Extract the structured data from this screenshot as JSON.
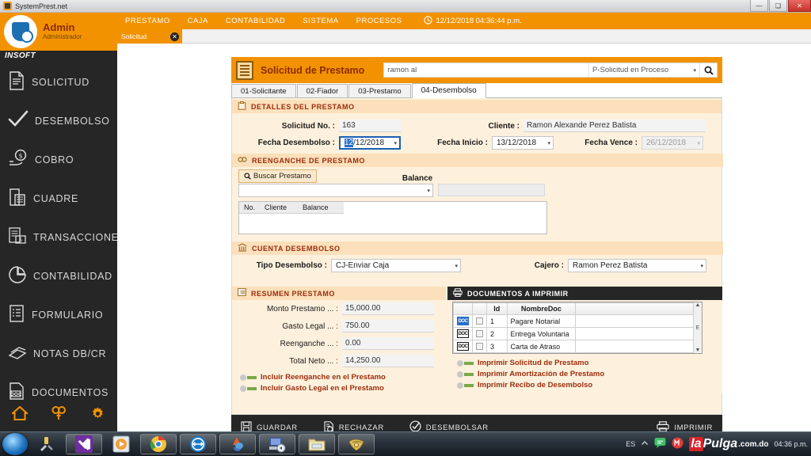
{
  "window": {
    "title": "SystemPrest.net",
    "buttons": {
      "minimize": "—",
      "maximize": "❑",
      "close": "✕"
    }
  },
  "sidebar": {
    "user": {
      "name": "Admin",
      "role": "Administrador",
      "brand": "INSOFT"
    },
    "items": [
      {
        "label": "SOLICITUD",
        "icon": "document-icon"
      },
      {
        "label": "DESEMBOLSO",
        "icon": "check-icon"
      },
      {
        "label": "COBRO",
        "icon": "hand-money-icon"
      },
      {
        "label": "CUADRE",
        "icon": "calculator-icon"
      },
      {
        "label": "TRANSACCIONES",
        "icon": "transactions-icon"
      },
      {
        "label": "CONTABILIDAD",
        "icon": "pie-chart-icon"
      },
      {
        "label": "FORMULARIO",
        "icon": "form-icon"
      },
      {
        "label": "NOTAS DB/CR",
        "icon": "notes-icon"
      },
      {
        "label": "DOCUMENTOS",
        "icon": "doc-icon"
      }
    ],
    "footer_icons": [
      {
        "name": "home-icon"
      },
      {
        "name": "key-icon"
      },
      {
        "name": "gear-icon"
      }
    ]
  },
  "topmenu": {
    "items": [
      "PRESTAMO",
      "CAJA",
      "CONTABILIDAD",
      "SISTEMA",
      "PROCESOS"
    ],
    "clock": "12/12/2018 04:36:44 p.m."
  },
  "doc_tab": {
    "label": "Solicitud",
    "close": "✕"
  },
  "form": {
    "title": "Solicitud de Prestamo",
    "search": {
      "value": "ramon al",
      "placeholder": "",
      "filter": "P-Solicitud en Proceso"
    },
    "tabs": [
      {
        "label": "01-Solicitante",
        "active": false
      },
      {
        "label": "02-Fiador",
        "active": false
      },
      {
        "label": "03-Prestamo",
        "active": false
      },
      {
        "label": "04-Desembolso",
        "active": true
      }
    ]
  },
  "detalles": {
    "heading": "DETALLES DEL PRESTAMO",
    "solicitud_no_label": "Solicitud No. :",
    "solicitud_no_value": "163",
    "cliente_label": "Cliente :",
    "cliente_value": "Ramon Alexande Perez Batista",
    "fecha_desembolso_label": "Fecha Desembolso :",
    "fecha_desembolso_sel": "12",
    "fecha_desembolso_rest": "/12/2018",
    "fecha_inicio_label": "Fecha Inicio :",
    "fecha_inicio_value": "13/12/2018",
    "fecha_vence_label": "Fecha Vence :",
    "fecha_vence_value": "26/12/2018"
  },
  "reenganche": {
    "heading": "REENGANCHE DE PRESTAMO",
    "buscar_label": "Buscar Prestamo",
    "balance_label": "Balance",
    "combo_value": "",
    "balance_value": "",
    "grid_headers": [
      "No.",
      "Cliente",
      "Balance"
    ],
    "grid_rows": []
  },
  "cuenta": {
    "heading": "CUENTA DESEMBOLSO",
    "tipo_label": "Tipo Desembolso :",
    "tipo_value": "CJ-Enviar Caja",
    "cajero_label": "Cajero :",
    "cajero_value": "Ramon Perez Batista"
  },
  "resumen": {
    "heading": "RESUMEN PRESTAMO",
    "rows": [
      {
        "label": "Monto Prestamo ... :",
        "value": "15,000.00"
      },
      {
        "label": "Gasto Legal ... :",
        "value": "750.00"
      },
      {
        "label": "Reenganche ... :",
        "value": "0.00"
      },
      {
        "label": "Total Neto ... :",
        "value": "14,250.00"
      }
    ],
    "toggles": [
      {
        "label": "Incluir Reenganche en el Prestamo",
        "on": false
      },
      {
        "label": "Incluir Gasto Legal en el Prestamo",
        "on": false
      }
    ]
  },
  "documentos": {
    "heading": "DOCUMENTOS A IMPRIMIR",
    "columns": [
      "",
      "",
      "Id",
      "NombreDoc"
    ],
    "rows": [
      {
        "id": "1",
        "nombre": "Pagare Notarial",
        "checked": false
      },
      {
        "id": "2",
        "nombre": "Entrega Voluntaria",
        "checked": false
      },
      {
        "id": "3",
        "nombre": "Carta de Atraso",
        "checked": false
      }
    ],
    "toggles": [
      {
        "label": "Imprimir Solicitud de Prestamo",
        "on": false
      },
      {
        "label": "Imprimir Amortización de Prestamo",
        "on": false
      },
      {
        "label": "Imprimir Recibo de Desembolso",
        "on": false
      }
    ],
    "scroll_up": "▲",
    "scroll_down": "▼",
    "scroll_mid": "E"
  },
  "actions": {
    "guardar": "GUARDAR",
    "rechazar": "RECHAZAR",
    "desembolsar": "DESEMBOLSAR",
    "imprimir": "IMPRIMIR"
  },
  "taskbar": {
    "lang": "ES",
    "clock_time": "04:36 p.m.",
    "watermark_la": "la",
    "watermark_pulga": "Pulga",
    "watermark_dot": ".com.do",
    "buttons": [
      {
        "name": "start-orb"
      },
      {
        "name": "tools-icon"
      },
      {
        "name": "visual-studio-icon"
      },
      {
        "name": "media-player-icon"
      },
      {
        "name": "chrome-icon"
      },
      {
        "name": "teamviewer-icon"
      },
      {
        "name": "paint-icon"
      },
      {
        "name": "computer-icon"
      },
      {
        "name": "folder-icon"
      },
      {
        "name": "money-app-icon"
      }
    ]
  },
  "colors": {
    "brand_orange": "#f39200",
    "panel_cream": "#fdf1dd",
    "section_cream": "#fbe0bb",
    "dark": "#262626",
    "heading_red": "#9c2d0c"
  }
}
